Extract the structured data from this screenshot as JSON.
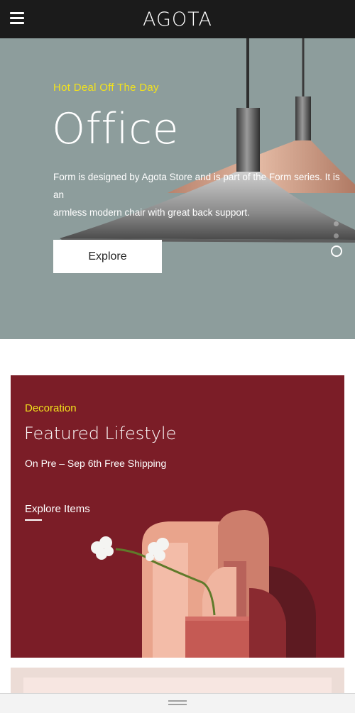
{
  "header": {
    "logo": "AGOTA",
    "menu_icon": "hamburger-icon"
  },
  "hero": {
    "kicker": "Hot Deal Off The Day",
    "title": "Office",
    "description_line1": "Form is designed by Agota Store and is part of the Form series. It is an",
    "description_line2": "armless modern chair with great back support.",
    "button_label": "Explore",
    "slider": {
      "slides": 3,
      "active_index": 2
    }
  },
  "featured": {
    "kicker": "Decoration",
    "title": "Featured Lifestyle",
    "subtitle": "On Pre – Sep 6th Free Shipping",
    "link_label": "Explore Items"
  },
  "bottom_bar": {
    "handle_icon": "drag-handle-icon"
  },
  "colors": {
    "header_bg": "#1b1b1b",
    "hero_bg": "#8d9d9c",
    "accent_yellow": "#f2e21c",
    "featured_bg": "#7b1d27",
    "next_card_bg": "#ecdcd6"
  }
}
